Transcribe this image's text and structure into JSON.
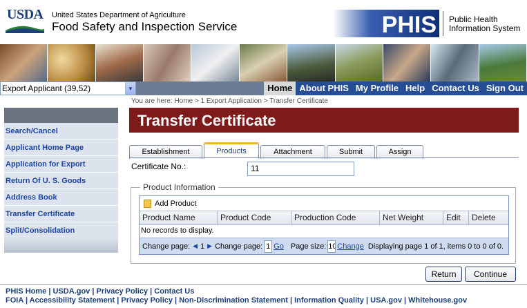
{
  "header": {
    "usda_logo_text": "USDA",
    "department": "United States Department of Agriculture",
    "agency": "Food Safety and Inspection Service",
    "phis_logo_text": "PHIS",
    "phis_name_line1": "Public Health",
    "phis_name_line2": "Information System"
  },
  "applicant_select": {
    "value": "Export Applicant (39,52)"
  },
  "nav": {
    "home": "Home",
    "about": "About PHIS",
    "profile": "My Profile",
    "help": "Help",
    "contact": "Contact Us",
    "signout": "Sign Out"
  },
  "breadcrumb": "You are here: Home > 1 Export Application > Transfer Certificate",
  "sidebar": {
    "items": [
      {
        "label": "Search/Cancel"
      },
      {
        "label": "Applicant Home Page"
      },
      {
        "label": "Application for Export"
      },
      {
        "label": "Return Of U. S. Goods"
      },
      {
        "label": "Address Book"
      },
      {
        "label": "Transfer Certificate"
      },
      {
        "label": "Split/Consolidation"
      }
    ]
  },
  "page_title": "Transfer Certificate",
  "tabs": [
    {
      "label": "Establishment"
    },
    {
      "label": "Products"
    },
    {
      "label": "Attachment"
    },
    {
      "label": "Submit"
    },
    {
      "label": "Assign"
    }
  ],
  "certificate": {
    "label": "Certificate No.:",
    "value": "11"
  },
  "product_info": {
    "legend": "Product Information",
    "add_label": "Add Product",
    "columns": [
      "Product Name",
      "Product Code",
      "Production Code",
      "Net Weight",
      "Edit",
      "Delete"
    ],
    "empty_text": "No records to display.",
    "pager": {
      "change_page_label": "Change page:",
      "page_number": "1",
      "change_page_label2": "Change page:",
      "page_input": "1",
      "go": "Go",
      "page_size_label": "Page size:",
      "page_size_input": "10",
      "change": "Change",
      "status": "Displaying page 1 of 1, items 0 to 0 of 0."
    }
  },
  "buttons": {
    "return": "Return",
    "continue": "Continue"
  },
  "footer": {
    "row1": [
      "PHIS Home",
      "USDA.gov",
      "Privacy Policy",
      "Contact Us"
    ],
    "row2": [
      "FOIA",
      "Accessibility Statement",
      "Privacy Policy",
      "Non-Discrimination Statement",
      "Information Quality",
      "USA.gov",
      "Whitehouse.gov"
    ]
  }
}
